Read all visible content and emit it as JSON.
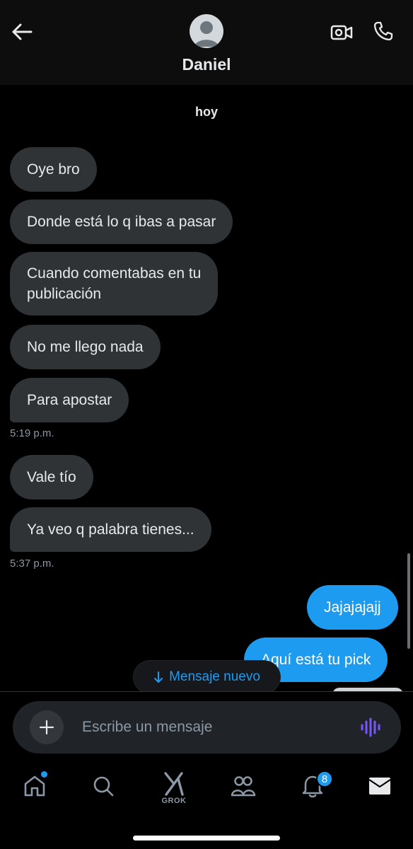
{
  "header": {
    "contact_name": "Daniel",
    "icons": {
      "back": "arrow-left-icon",
      "video": "video-camera-icon",
      "call": "phone-icon"
    }
  },
  "conversation": {
    "date_separator": "hoy",
    "messages": [
      {
        "direction": "in",
        "text": "Oye bro"
      },
      {
        "direction": "in",
        "text": "Donde está lo q ibas a pasar"
      },
      {
        "direction": "in",
        "text": "Cuando comentabas en tu\npublicación"
      },
      {
        "direction": "in",
        "text": "No me llego nada"
      },
      {
        "direction": "in",
        "text": "Para apostar"
      },
      {
        "direction": "in",
        "text": "Vale tío"
      },
      {
        "direction": "in",
        "text": "Ya veo q palabra tienes..."
      },
      {
        "direction": "out",
        "text": "Jajajajajj"
      },
      {
        "direction": "out",
        "text": "Aquí está tu pick"
      }
    ],
    "timestamps": [
      "5:19 p.m.",
      "5:37 p.m."
    ]
  },
  "new_message_pill": {
    "label": "Mensaje nuevo",
    "icon": "arrow-down-icon"
  },
  "composer": {
    "placeholder": "Escribe un mensaje"
  },
  "tabbar": {
    "grok_label": "GROK",
    "notifications_count": "8",
    "colors": {
      "accent": "#1d9bf0",
      "icon": "#8b98a5"
    }
  },
  "colors": {
    "incoming_bubble": "#2f3336",
    "outgoing_bubble": "#1d9bf0",
    "voice_icon": "#7856ff"
  }
}
